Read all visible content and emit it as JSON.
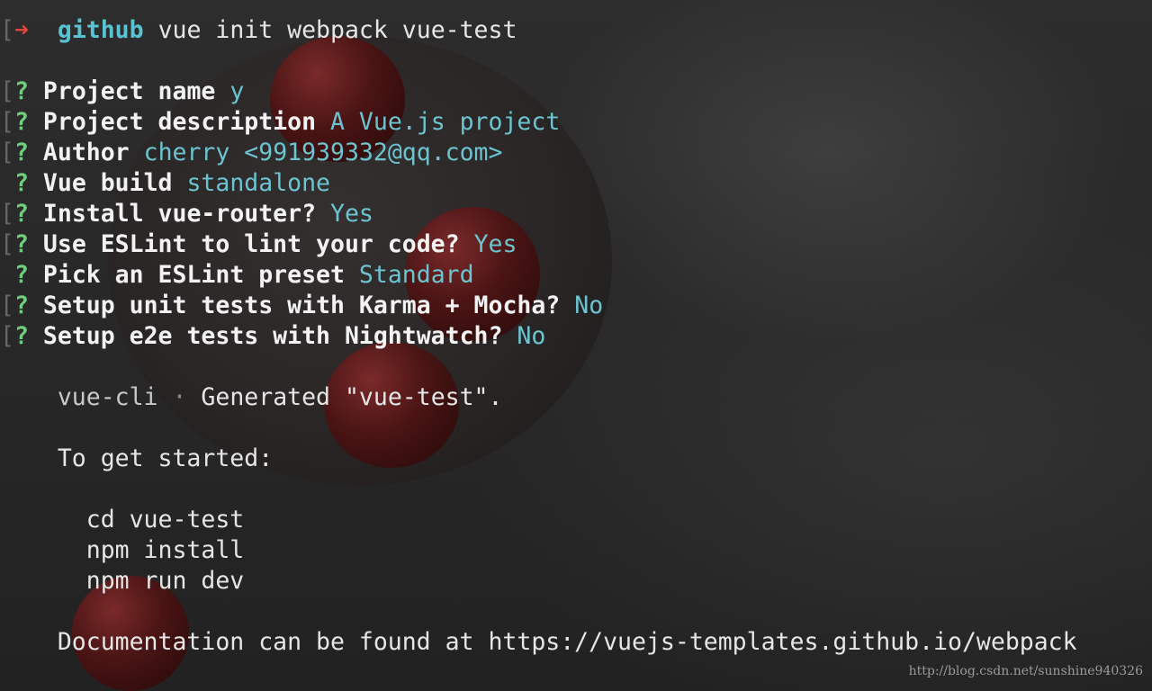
{
  "prompt": {
    "bracket": "[",
    "arrow": "➜",
    "directory": "github",
    "command": "vue init webpack vue-test"
  },
  "questions": [
    {
      "bracket": "[",
      "mark": "?",
      "question": "Project name",
      "answer": "y"
    },
    {
      "bracket": "[",
      "mark": "?",
      "question": "Project description",
      "answer": "A Vue.js project"
    },
    {
      "bracket": "[",
      "mark": "?",
      "question": "Author",
      "answer": "cherry <991939332@qq.com>"
    },
    {
      "bracket": "",
      "mark": "?",
      "question": "Vue build",
      "answer": "standalone"
    },
    {
      "bracket": "[",
      "mark": "?",
      "question": "Install vue-router?",
      "answer": "Yes"
    },
    {
      "bracket": "[",
      "mark": "?",
      "question": "Use ESLint to lint your code?",
      "answer": "Yes"
    },
    {
      "bracket": "",
      "mark": "?",
      "question": "Pick an ESLint preset",
      "answer": "Standard"
    },
    {
      "bracket": "[",
      "mark": "?",
      "question": "Setup unit tests with Karma + Mocha?",
      "answer": "No"
    },
    {
      "bracket": "[",
      "mark": "?",
      "question": "Setup e2e tests with Nightwatch?",
      "answer": "No"
    }
  ],
  "result": {
    "tool": "vue-cli",
    "separator": "·",
    "message": "Generated \"vue-test\".",
    "get_started": "To get started:",
    "commands": [
      "cd vue-test",
      "npm install",
      "npm run dev"
    ],
    "docs": "Documentation can be found at https://vuejs-templates.github.io/webpack"
  },
  "watermark": "http://blog.csdn.net/sunshine940326",
  "colors": {
    "background": "#262626",
    "question_mark": "#6fce7d",
    "answer": "#6cc4d1",
    "arrow": "#e0473a",
    "directory": "#59c3d4"
  }
}
